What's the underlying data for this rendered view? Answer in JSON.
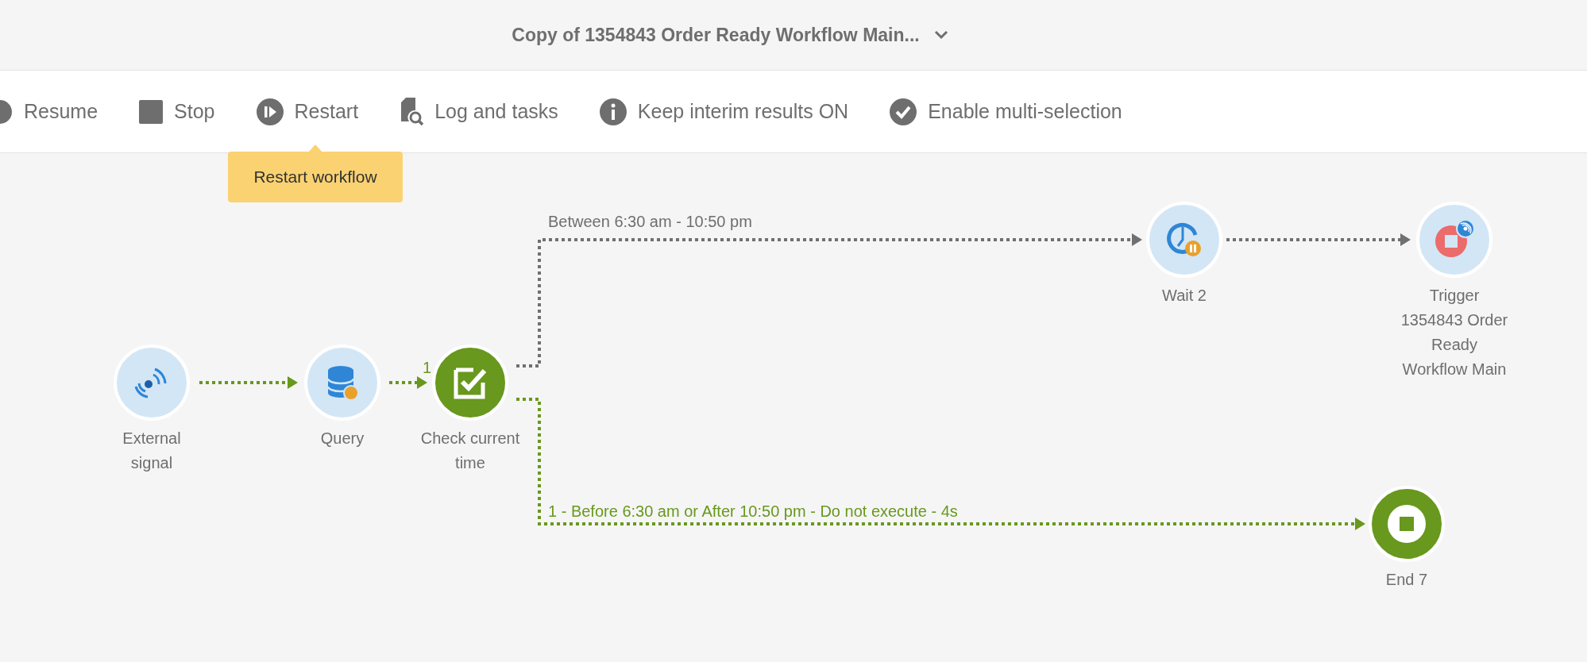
{
  "window": {
    "title": "Copy of 1354843 Order Ready Workflow Main..."
  },
  "toolbar": [
    {
      "kind": "resume",
      "label": "Resume"
    },
    {
      "kind": "stop",
      "label": "Stop"
    },
    {
      "kind": "restart",
      "label": "Restart"
    },
    {
      "kind": "log",
      "label": "Log and tasks"
    },
    {
      "kind": "info",
      "label": "Keep interim results ON"
    },
    {
      "kind": "check",
      "label": "Enable multi-selection"
    }
  ],
  "tooltip": {
    "text": "Restart workflow"
  },
  "nodes": [
    {
      "kind": "signal",
      "label": "External signal",
      "completed": false
    },
    {
      "kind": "query",
      "label": "Query",
      "completed": false
    },
    {
      "kind": "test",
      "label": "Check current time",
      "completed": true
    },
    {
      "kind": "wait",
      "label": "Wait 2",
      "completed": false
    },
    {
      "kind": "trigger",
      "label": "Trigger 1354843 Order Ready Workflow Main",
      "completed": false
    },
    {
      "kind": "end",
      "label": "End 7",
      "completed": true
    }
  ],
  "transitions": [
    {
      "executed": true
    },
    {
      "executed": true,
      "label": "1"
    },
    {
      "executed": false,
      "label": "Between 6:30 am - 10:50 pm"
    },
    {
      "executed": false
    },
    {
      "executed": true,
      "label": "1 - Before 6:30 am or After 10:50 pm - Do not execute - 4s"
    }
  ]
}
